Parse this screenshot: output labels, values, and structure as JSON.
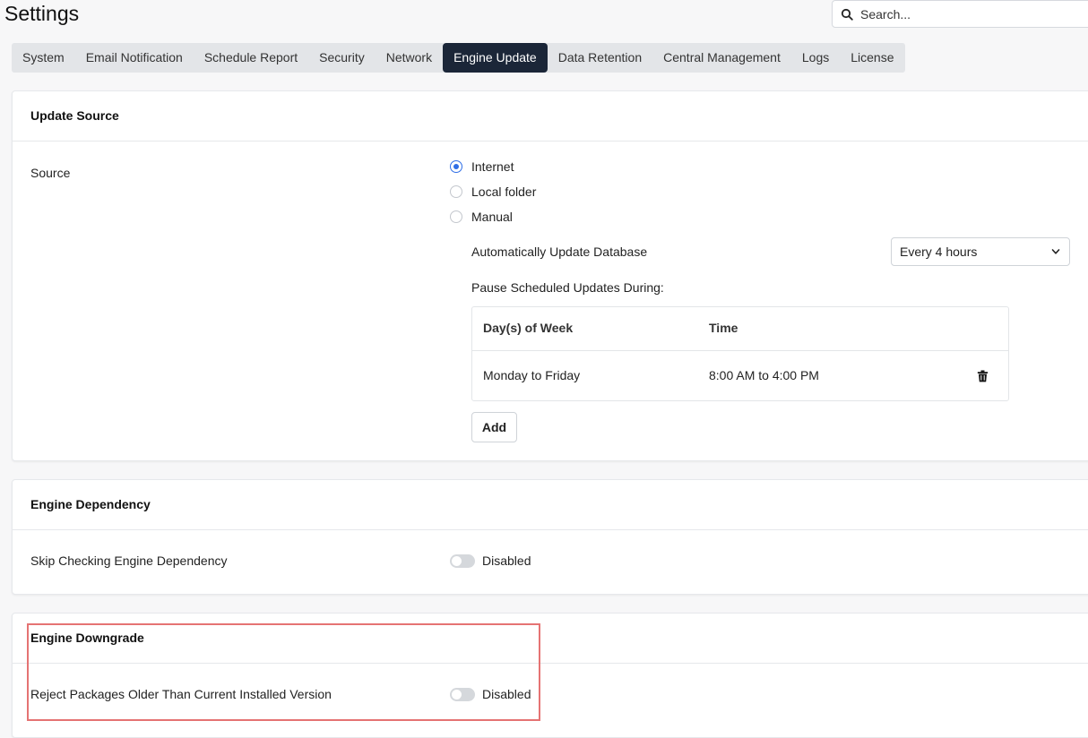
{
  "page": {
    "title": "Settings"
  },
  "search": {
    "placeholder": "Search..."
  },
  "tabs": [
    {
      "label": "System"
    },
    {
      "label": "Email Notification"
    },
    {
      "label": "Schedule Report"
    },
    {
      "label": "Security"
    },
    {
      "label": "Network"
    },
    {
      "label": "Engine Update",
      "active": true
    },
    {
      "label": "Data Retention"
    },
    {
      "label": "Central Management"
    },
    {
      "label": "Logs"
    },
    {
      "label": "License"
    }
  ],
  "update_source": {
    "title": "Update Source",
    "source_label": "Source",
    "options": [
      {
        "label": "Internet",
        "selected": true
      },
      {
        "label": "Local folder",
        "selected": false
      },
      {
        "label": "Manual",
        "selected": false
      }
    ],
    "auto_update_label": "Automatically Update Database",
    "auto_update_value": "Every 4 hours",
    "pause_label": "Pause Scheduled Updates During:",
    "pause_table": {
      "headers": [
        "Day(s) of Week",
        "Time"
      ],
      "rows": [
        {
          "days": "Monday to Friday",
          "time": "8:00 AM to 4:00 PM"
        }
      ]
    },
    "add_label": "Add"
  },
  "engine_dependency": {
    "title": "Engine Dependency",
    "setting_label": "Skip Checking Engine Dependency",
    "status": "Disabled"
  },
  "engine_downgrade": {
    "title": "Engine Downgrade",
    "setting_label": "Reject Packages Older Than Current Installed Version",
    "status": "Disabled"
  },
  "colors": {
    "active_tab_bg": "#1b2638",
    "radio_selected": "#2f6ee6",
    "highlight_border": "#e57373",
    "toggle_off": "#d5d8dc"
  }
}
